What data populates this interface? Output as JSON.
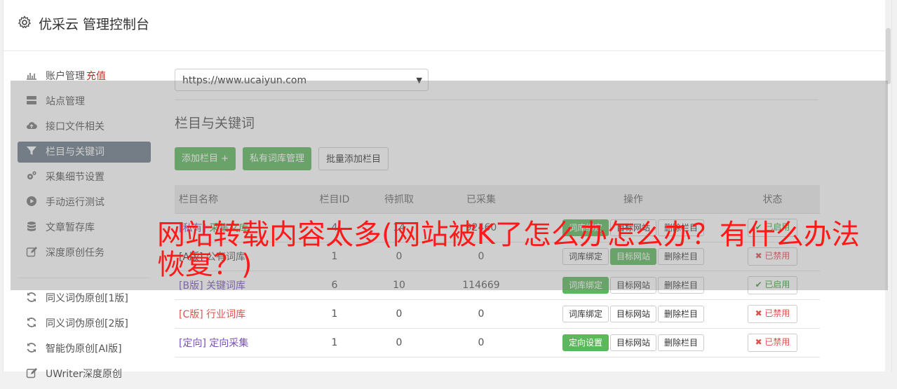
{
  "header": {
    "title": "优采云 管理控制台",
    "icon": "gear-icon"
  },
  "sidebar": {
    "items": [
      {
        "label": "账户管理",
        "extra": "充值",
        "icon": "bar-chart-icon",
        "active": false
      },
      {
        "label": "站点管理",
        "icon": "server-icon",
        "active": false
      },
      {
        "label": "接口文件相关",
        "icon": "cloud-upload-icon",
        "active": false
      },
      {
        "label": "栏目与关键词",
        "icon": "filter-icon",
        "active": true
      },
      {
        "label": "采集细节设置",
        "icon": "cogs-icon",
        "active": false
      },
      {
        "label": "手动运行测试",
        "icon": "play-circle-icon",
        "active": false
      },
      {
        "label": "文章暂存库",
        "icon": "database-icon",
        "active": false
      },
      {
        "label": "深度原创任务",
        "icon": "edit-icon",
        "active": false
      }
    ],
    "items2": [
      {
        "label": "同义词伪原创[1版]",
        "icon": "refresh-icon"
      },
      {
        "label": "同义词伪原创[2版]",
        "icon": "refresh-icon"
      },
      {
        "label": "智能伪原创[AI版]",
        "icon": "refresh-icon"
      },
      {
        "label": "UWriter深度原创",
        "icon": "edit-icon"
      }
    ]
  },
  "site_select": {
    "value": "https://www.ucaiyun.com"
  },
  "section": {
    "title": "栏目与关键词"
  },
  "buttons": {
    "add": "添加栏目 +",
    "private_lib": "私有词库管理",
    "batch_add": "批量添加栏目"
  },
  "table": {
    "headers": [
      "栏目名称",
      "栏目ID",
      "待抓取",
      "已采集",
      "操作",
      "状态"
    ],
    "rows": [
      {
        "tag": "[私有]",
        "name": "采集文库",
        "id": "4",
        "pending": "14",
        "collected": "92460",
        "op1": "词库绑定",
        "op1_green": true,
        "op2": "目标网站",
        "op2_green": false,
        "op3": "删除栏目",
        "status": "✔ 已启用",
        "status_kind": "enabled"
      },
      {
        "tag": "[A版]",
        "name": "公有词库",
        "id": "1",
        "pending": "0",
        "collected": "0",
        "op1": "词库绑定",
        "op1_green": false,
        "op2": "目标网站",
        "op2_green": true,
        "op3": "删除栏目",
        "status": "✖ 已禁用",
        "status_kind": "disabled"
      },
      {
        "tag": "[B版]",
        "name": "关键词库",
        "id": "6",
        "pending": "10",
        "collected": "114669",
        "op1": "词库绑定",
        "op1_green": true,
        "op2": "目标网站",
        "op2_green": false,
        "op3": "删除栏目",
        "status": "✔ 已启用",
        "status_kind": "enabled"
      },
      {
        "tag": "[C版]",
        "name": "行业词库",
        "id": "1",
        "pending": "0",
        "collected": "0",
        "op1": "词库绑定",
        "op1_green": false,
        "op2": "目标网站",
        "op2_green": false,
        "op3": "删除栏目",
        "status": "✖ 已禁用",
        "status_kind": "disabled"
      },
      {
        "tag": "[定向]",
        "name": "定向采集",
        "id": "1",
        "pending": "0",
        "collected": "0",
        "op1": "定向设置",
        "op1_green": true,
        "op2": "目标网站",
        "op2_green": false,
        "op3": "删除栏目",
        "status": "✖ 已禁用",
        "status_kind": "disabled"
      }
    ]
  },
  "overlay": {
    "headline": "网站转载内容太多(网站被K了怎么办怎么办？有什么办法恢复？)"
  },
  "colors": {
    "accent_green": "#5cb85c",
    "sidebar_active": "#6d7a8a",
    "headline_red": "#ff1a1a"
  }
}
